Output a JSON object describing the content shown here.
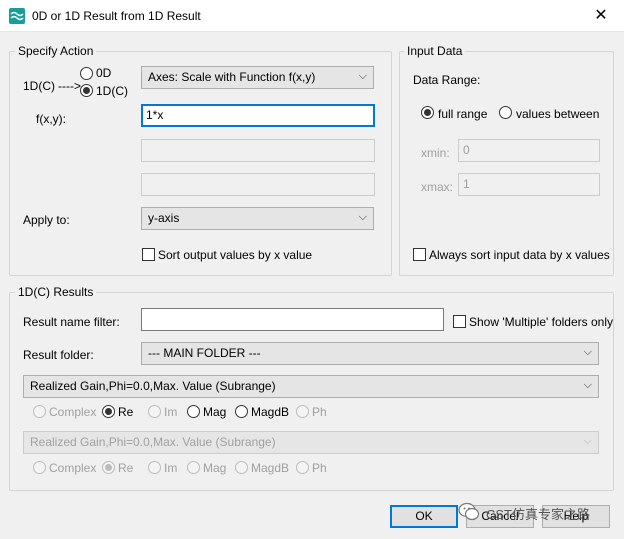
{
  "window": {
    "title": "0D or 1D Result from 1D Result",
    "close_glyph": "✕"
  },
  "specify_action": {
    "legend": "Specify Action",
    "type_label": "1D(C)",
    "arrow_text": "---->",
    "radio_0d": "0D",
    "radio_1dc": "1D(C)",
    "action_select": "Axes: Scale with Function f(x,y)",
    "fxy_label": "f(x,y):",
    "fxy_value": "1*x",
    "extra_field_1": "",
    "extra_field_2": "",
    "apply_to_label": "Apply to:",
    "apply_to_value": "y-axis",
    "sort_output_label": "Sort output values by x value"
  },
  "input_data": {
    "legend": "Input Data",
    "data_range_label": "Data Range:",
    "full_range_label": "full range",
    "values_between_label": "values between",
    "xmin_label": "xmin:",
    "xmin_value": "0",
    "xmax_label": "xmax:",
    "xmax_value": "1",
    "always_sort_label": "Always sort input data by x values"
  },
  "results": {
    "legend": "1D(C) Results",
    "name_filter_label": "Result name filter:",
    "name_filter_value": "",
    "show_multiple_label": "Show 'Multiple' folders only",
    "folder_label": "Result folder:",
    "folder_value": "--- MAIN FOLDER ---",
    "result1_select": "Realized Gain,Phi=0.0,Max. Value (Subrange)",
    "result2_select": "Realized Gain,Phi=0.0,Max. Value (Subrange)",
    "options": [
      "Complex",
      "Re",
      "Im",
      "Mag",
      "MagdB",
      "Ph"
    ]
  },
  "buttons": {
    "ok": "OK",
    "cancel": "Cancel",
    "help": "Help"
  },
  "watermark": {
    "text": "CST仿真专家之路"
  },
  "colors": {
    "accent": "#0078d7",
    "window_bg": "#f0f0f0",
    "icon_teal": "#1a9c9c"
  }
}
